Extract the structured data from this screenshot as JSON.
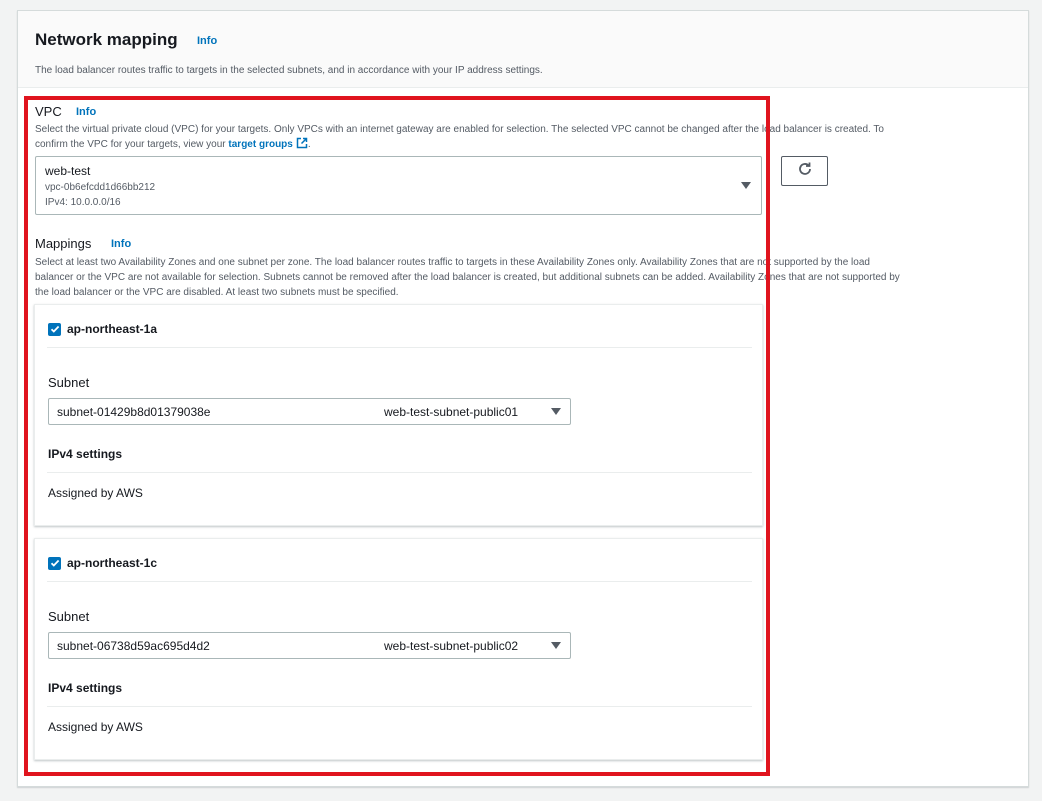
{
  "section": {
    "title": "Network mapping",
    "info_label": "Info",
    "description": "The load balancer routes traffic to targets in the selected subnets, and in accordance with your IP address settings."
  },
  "vpc": {
    "label": "VPC",
    "info_label": "Info",
    "description_line1": "Select the virtual private cloud (VPC) for your targets. Only VPCs with an internet gateway are enabled for selection. The selected VPC cannot be changed after the load balancer is created. To",
    "description_line2_prefix": "confirm the VPC for your targets, view your ",
    "target_groups_link": "target groups",
    "description_line2_suffix": ".",
    "selected_name": "web-test",
    "selected_id": "vpc-0b6efcdd1d66bb212",
    "selected_cidr": "IPv4: 10.0.0.0/16",
    "refresh_icon": "refresh-icon"
  },
  "mappings": {
    "label": "Mappings",
    "info_label": "Info",
    "description_line1": "Select at least two Availability Zones and one subnet per zone. The load balancer routes traffic to targets in these Availability Zones only. Availability Zones that are not supported by the load",
    "description_line2": "balancer or the VPC are not available for selection. Subnets cannot be removed after the load balancer is created, but additional subnets can be added. Availability Zones that are not supported by",
    "description_line3": "the load balancer or the VPC are disabled. At least two subnets must be specified.",
    "zones": [
      {
        "name": "ap-northeast-1a",
        "checked": true,
        "subnet_label": "Subnet",
        "subnet_id": "subnet-01429b8d01379038e",
        "subnet_name": "web-test-subnet-public01",
        "ipv4_title": "IPv4 settings",
        "ipv4_value": "Assigned by AWS"
      },
      {
        "name": "ap-northeast-1c",
        "checked": true,
        "subnet_label": "Subnet",
        "subnet_id": "subnet-06738d59ac695d4d2",
        "subnet_name": "web-test-subnet-public02",
        "ipv4_title": "IPv4 settings",
        "ipv4_value": "Assigned by AWS"
      }
    ]
  },
  "colors": {
    "accent": "#0073bb",
    "highlight_border": "#e0141e",
    "text": "#16191f",
    "muted_text": "#545b64"
  }
}
